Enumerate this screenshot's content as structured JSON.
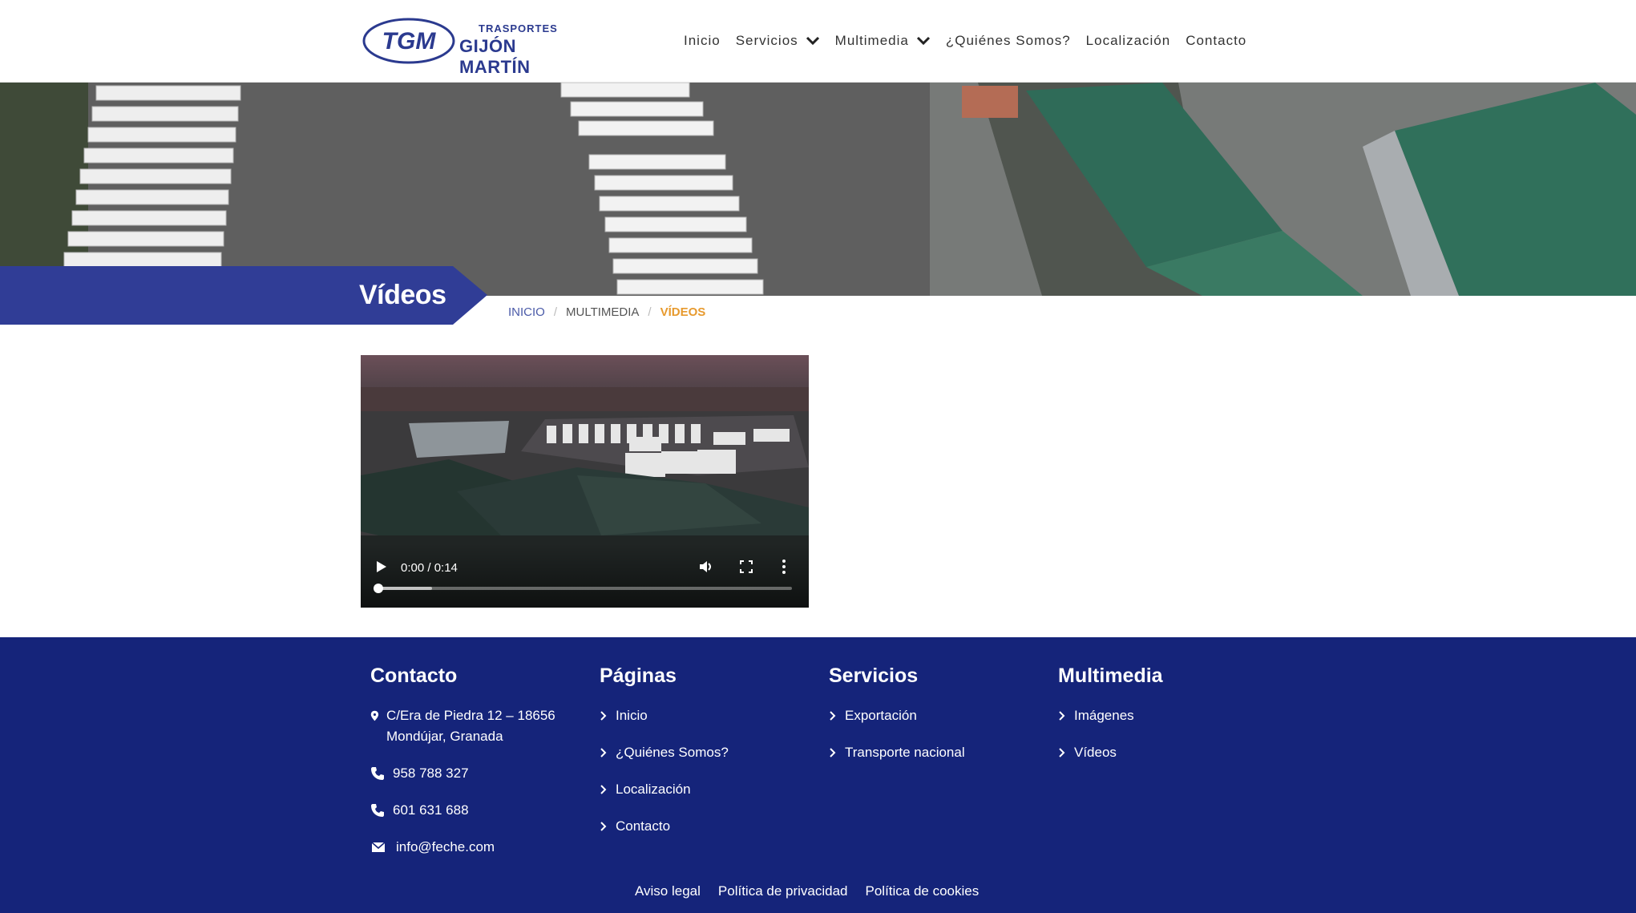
{
  "brand": {
    "logo_mark": "TGM",
    "logo_subtitle": "TRASPORTES",
    "logo_name": "GIJÓN MARTÍN",
    "primary_color": "#2b3a8f",
    "accent_color": "#e79a2e",
    "footer_color": "#15247a"
  },
  "nav": {
    "items": [
      {
        "label": "Inicio"
      },
      {
        "label": "Servicios",
        "icon": "chevron-down-icon"
      },
      {
        "label": "Multimedia",
        "icon": "chevron-down-icon"
      },
      {
        "label": "¿Quiénes Somos?"
      },
      {
        "label": "Localización"
      },
      {
        "label": "Contacto"
      }
    ]
  },
  "page": {
    "title": "Vídeos"
  },
  "breadcrumb": {
    "items": [
      "INICIO",
      "MULTIMEDIA",
      "VÍDEOS"
    ],
    "separator": "/"
  },
  "video": {
    "time": "0:00 / 0:14",
    "progress": 0,
    "buffered": 0.13,
    "icons": [
      "play-icon",
      "volume-icon",
      "fullscreen-icon",
      "more-options-icon"
    ]
  },
  "footer": {
    "contact": {
      "heading": "Contacto",
      "address": "C/Era de Piedra 12 – 18656 Mondújar, Granada",
      "phone1": "958 788 327",
      "phone2": "601 631 688",
      "email": "info@feche.com"
    },
    "pages": {
      "heading": "Páginas",
      "items": [
        "Inicio",
        "¿Quiénes Somos?",
        "Localización",
        "Contacto"
      ]
    },
    "services": {
      "heading": "Servicios",
      "items": [
        "Exportación",
        "Transporte nacional"
      ]
    },
    "multimedia": {
      "heading": "Multimedia",
      "items": [
        "Imágenes",
        "Vídeos"
      ]
    },
    "legal": [
      "Aviso legal",
      "Política de privacidad",
      "Política de cookies"
    ]
  }
}
